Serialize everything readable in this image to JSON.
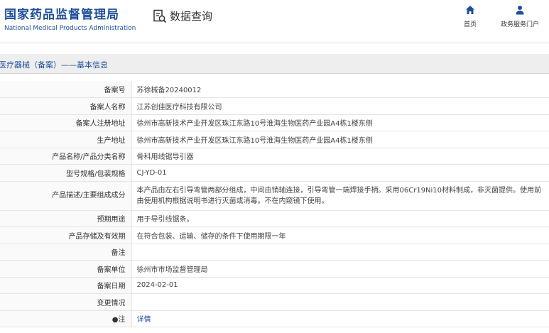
{
  "header": {
    "logo_cn": "国家药品监督管理局",
    "logo_en": "National Medical Products Administration",
    "query_label": "数据查询",
    "nav": [
      {
        "label": "首页",
        "icon": "home-icon"
      },
      {
        "label": "政务服务门户",
        "icon": "user-icon"
      }
    ]
  },
  "section": {
    "title": "医疗器械（备案）——基本信息"
  },
  "rows": [
    {
      "key": "备案号",
      "value": "苏徐械备20240012"
    },
    {
      "key": "备案人名称",
      "value": "江苏创佳医疗科技有限公司"
    },
    {
      "key": "备案人注册地址",
      "value": "徐州市高新技术产业开发区珠江东路10号淮海生物医药产业园A4栋1楼东侧"
    },
    {
      "key": "生产地址",
      "value": "徐州市高新技术产业开发区珠江东路10号淮海生物医药产业园A4栋1楼东侧"
    },
    {
      "key": "产品名称/产品分类名称",
      "value": "骨科用线锯导引器"
    },
    {
      "key": "型号规格/包装规格",
      "value": "CJ-YD-01"
    },
    {
      "key": "产品描述/主要组成成分",
      "value": "本产品由左右引导弯管两部分组成，中间由销轴连接，引导弯管一端焊接手柄。采用06Cr19Ni10材料制成，非灭菌提供。使用前由使用机构根据说明书进行灭菌或消毒。不在内窥镜下使用。"
    },
    {
      "key": "预期用途",
      "value": "用于导引线锯条。"
    },
    {
      "key": "产品存储及有效期",
      "value": "在符合包装、运输、储存的条件下使用期限一年"
    },
    {
      "key": "备注",
      "value": ""
    },
    {
      "key": "备案单位",
      "value": "徐州市市场监督管理局"
    },
    {
      "key": "备案日期",
      "value": "2024-02-01"
    },
    {
      "key": "变更情况",
      "value": ""
    },
    {
      "key": "●注",
      "value": "详情"
    }
  ],
  "colors": {
    "brand": "#1e4e9a",
    "section_bg": "#eeeeee"
  }
}
